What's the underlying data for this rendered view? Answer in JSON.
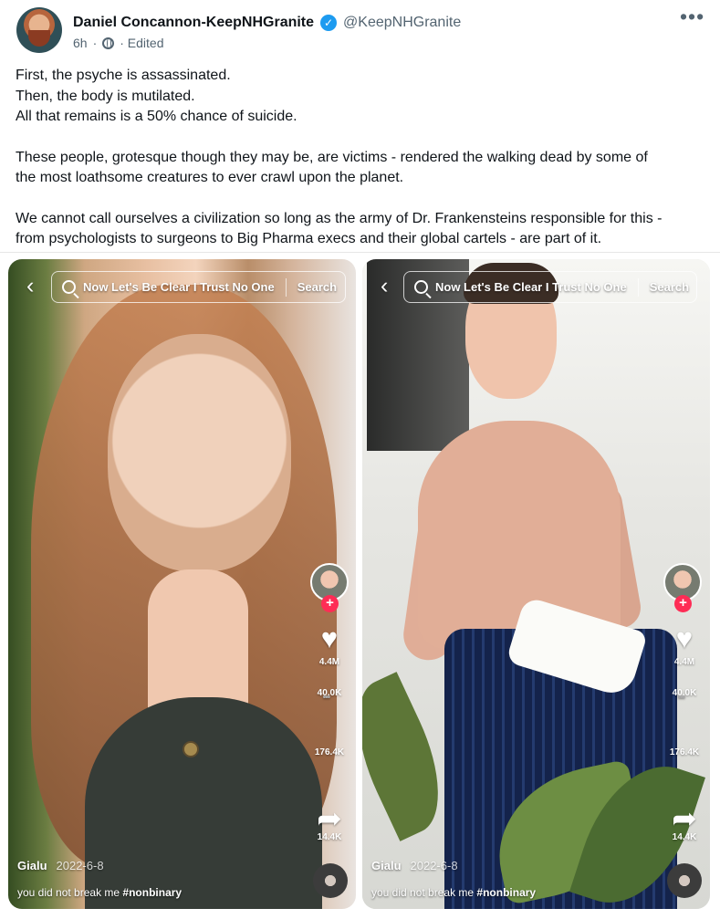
{
  "post": {
    "author_name": "Daniel Concannon-KeepNHGranite",
    "handle": "@KeepNHGranite",
    "time": "6h",
    "edited": "· Edited",
    "paragraphs": [
      [
        "First, the psyche is assassinated.",
        "Then, the body is mutilated.",
        "All that remains is a 50% chance of suicide."
      ],
      [
        "These people, grotesque though they may be, are victims - rendered the walking dead by some of",
        "the most loathsome creatures to ever crawl upon the planet."
      ],
      [
        "We cannot call ourselves a civilization so long as the army of Dr. Frankensteins responsible for this -",
        "from psychologists to surgeons to Big Pharma execs and their global cartels - are part of it."
      ]
    ]
  },
  "media": {
    "left": {
      "search_query": "Now Let's Be Clear I Trust No One",
      "search_button": "Search",
      "likes": "4.4M",
      "comments": "40.0K",
      "saves": "176.4K",
      "shares": "14.4K",
      "username": "Gialu",
      "date": "2022-6-8",
      "caption": "you did not break me",
      "hashtag": "#nonbinary"
    },
    "right": {
      "search_query": "Now Let's Be Clear I Trust No One",
      "search_button": "Search",
      "likes": "4.4M",
      "comments": "40.0K",
      "saves": "176.4K",
      "shares": "14.4K",
      "username": "Gialu",
      "date": "2022-6-8",
      "caption": "you did not break me",
      "hashtag": "#nonbinary"
    }
  },
  "icons": {
    "avatar": "author-avatar-image",
    "verified": "verified-badge-icon",
    "globe": "globe-icon",
    "more": "more-options-icon",
    "search": "search-icon",
    "back": "back-arrow-icon",
    "like": "heart-icon",
    "comment": "comment-icon",
    "save": "bookmark-icon",
    "share": "share-icon",
    "music": "music-disc-icon"
  },
  "colors": {
    "text_primary": "#0f1419",
    "text_secondary": "#536471",
    "verified": "#1d9bf0",
    "tiktok_red": "#fe2c55",
    "white": "#ffffff"
  }
}
